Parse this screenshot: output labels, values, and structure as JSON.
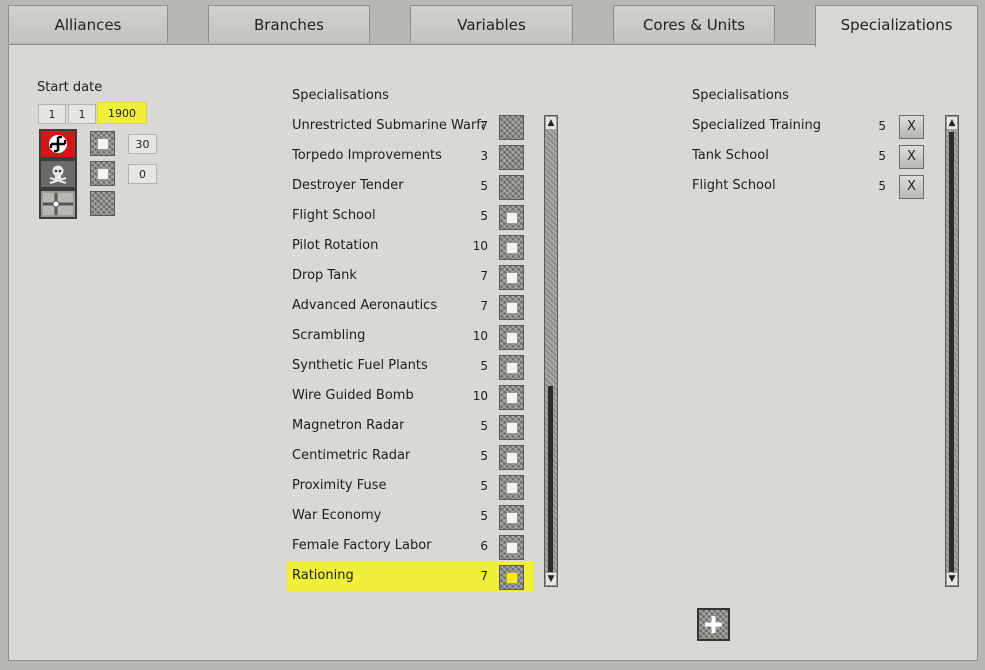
{
  "tabs": [
    "Alliances",
    "Branches",
    "Variables",
    "Cores & Units",
    "Specializations"
  ],
  "left": {
    "start_date_label": "Start date",
    "day": "1",
    "month": "1",
    "year": "1900",
    "value_a": "30",
    "value_b": "0",
    "flags": [
      "germany-flag-icon",
      "skull-flag-icon",
      "naval-ensign-icon"
    ]
  },
  "available": {
    "header": "Specialisations",
    "items": [
      {
        "name": "Unrestricted Submarine Warfare",
        "cost": "7"
      },
      {
        "name": "Torpedo Improvements",
        "cost": "3"
      },
      {
        "name": "Destroyer Tender",
        "cost": "5"
      },
      {
        "name": "Flight School",
        "cost": "5"
      },
      {
        "name": "Pilot Rotation",
        "cost": "10"
      },
      {
        "name": "Drop Tank",
        "cost": "7"
      },
      {
        "name": "Advanced Aeronautics",
        "cost": "7"
      },
      {
        "name": "Scrambling",
        "cost": "10"
      },
      {
        "name": "Synthetic Fuel Plants",
        "cost": "5"
      },
      {
        "name": "Wire Guided Bomb",
        "cost": "10"
      },
      {
        "name": "Magnetron Radar",
        "cost": "5"
      },
      {
        "name": "Centimetric Radar",
        "cost": "5"
      },
      {
        "name": "Proximity Fuse",
        "cost": "5"
      },
      {
        "name": "War Economy",
        "cost": "5"
      },
      {
        "name": "Female Factory Labor",
        "cost": "6"
      },
      {
        "name": "Rationing",
        "cost": "7"
      }
    ]
  },
  "selected": {
    "header": "Specialisations",
    "items": [
      {
        "name": "Specialized Training",
        "cost": "5",
        "remove": "X"
      },
      {
        "name": "Tank School",
        "cost": "5",
        "remove": "X"
      },
      {
        "name": "Flight School",
        "cost": "5",
        "remove": "X"
      }
    ]
  },
  "colors": {
    "highlight": "#f0f03a",
    "flag_red": "#d01818"
  }
}
